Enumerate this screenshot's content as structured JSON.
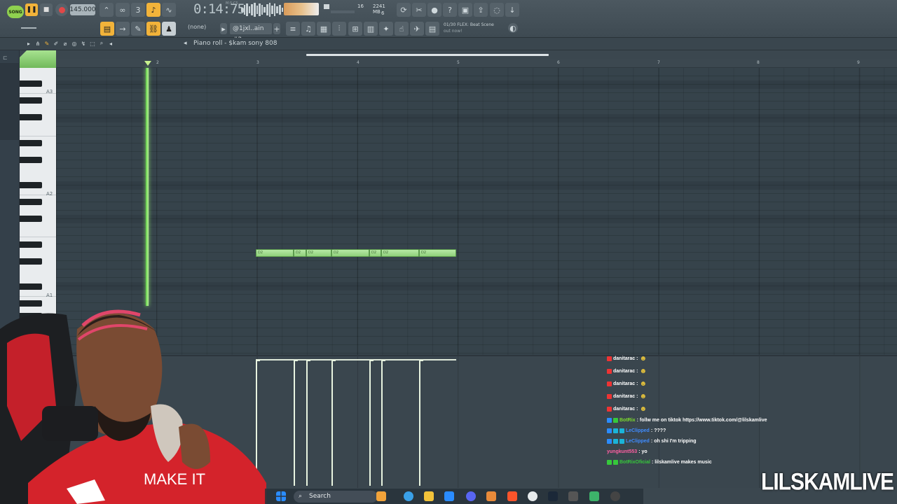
{
  "toolbar": {
    "mode_label": "SONG",
    "tempo": "145.000",
    "time": "0:14:75",
    "time_sub": "M:S:CS",
    "cpu_value": "16",
    "memory": "2241 MB",
    "polyphony": "6",
    "pattern_none": "(none)",
    "pattern_selector": "@1jxl..ain #2",
    "hint_line1": "01/30  FLEX: Beat Scene",
    "hint_line2": "out now!"
  },
  "piano_roll": {
    "title": "Piano roll - $kam sony 808",
    "ruler_numbers": [
      "2",
      "3",
      "4",
      "5",
      "6",
      "7",
      "8",
      "9"
    ],
    "key_labels": [
      "A3",
      "A2",
      "A1"
    ],
    "note_label": "D2"
  },
  "chat": {
    "messages": [
      {
        "user": "danitarac",
        "text": "",
        "user_color": "#ffffff"
      },
      {
        "user": "danitarac",
        "text": "",
        "user_color": "#ffffff"
      },
      {
        "user": "danitarac",
        "text": "",
        "user_color": "#ffffff"
      },
      {
        "user": "danitarac",
        "text": "",
        "user_color": "#ffffff"
      },
      {
        "user": "danitarac",
        "text": "",
        "user_color": "#ffffff"
      },
      {
        "user": "BotRix",
        "text": "follw me on tiktok https://www.tiktok.com/@lilskamlive",
        "user_color": "#7ddc2e"
      },
      {
        "user": "LeClipped",
        "text": "????",
        "user_color": "#3f8cff"
      },
      {
        "user": "LeClipped",
        "text": "oh shi I'm tripping",
        "user_color": "#3f8cff"
      },
      {
        "user": "yungkunt553",
        "text": "yo",
        "user_color": "#ff5fa2"
      },
      {
        "user": "BotRixOficial",
        "text": "lilskamlive makes music",
        "user_color": "#36c83b"
      }
    ]
  },
  "taskbar": {
    "search_label": "Search"
  },
  "watermark": "LILSKAMLIVE",
  "colors": {
    "accent_green": "#8fd14f",
    "note_fill": "#9bd985",
    "background": "#36434b"
  }
}
